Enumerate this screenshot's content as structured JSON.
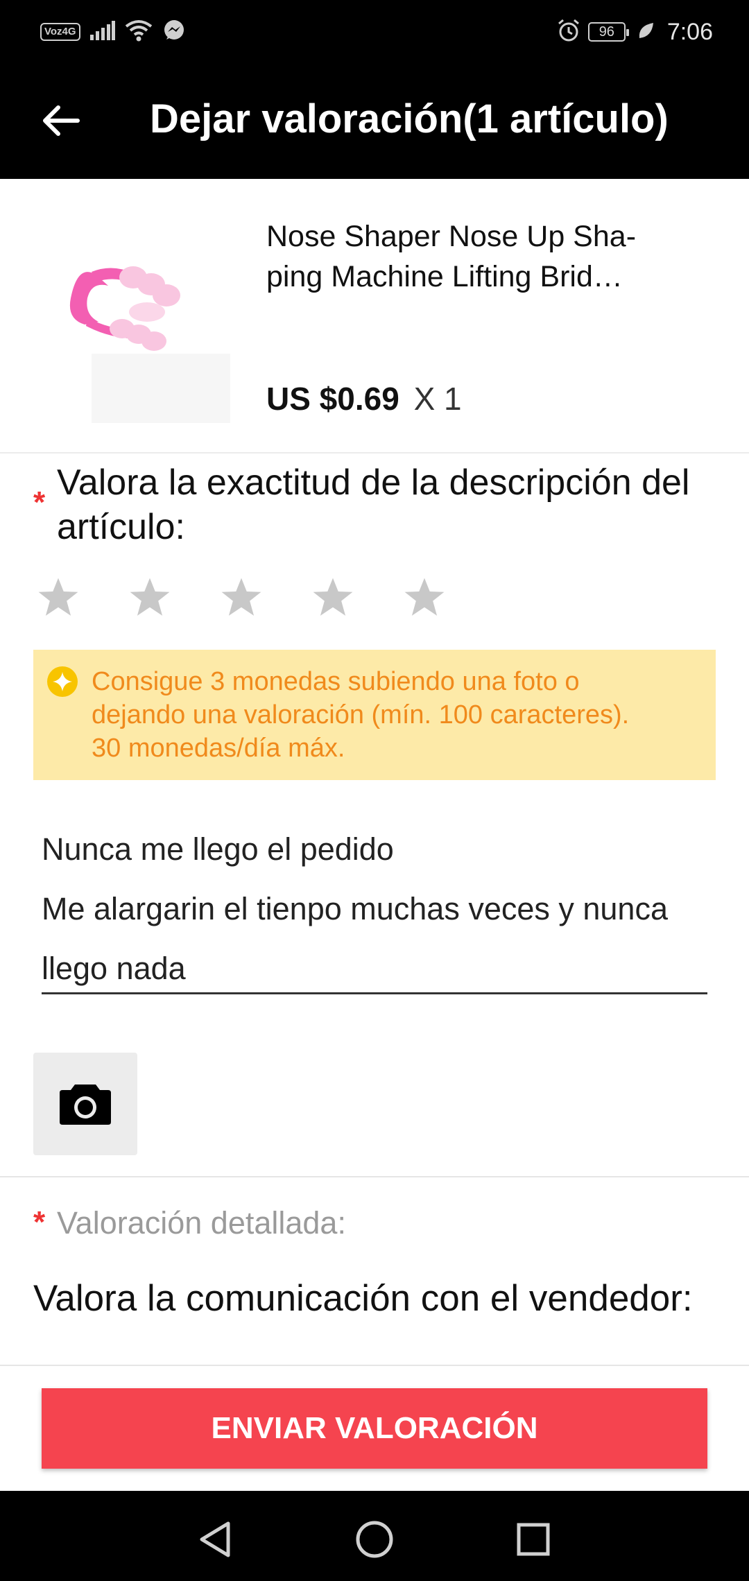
{
  "status_bar": {
    "network_badge": "Voz4G",
    "battery": "96",
    "time": "7:06",
    "icons": [
      "signal-icon",
      "wifi-icon",
      "messenger-icon",
      "alarm-icon",
      "battery-icon",
      "leaf-icon"
    ]
  },
  "header": {
    "title": "Dejar valoración(1 artículo)"
  },
  "product": {
    "name": "Nose Shaper Nose Up Sha-\nping Machine Lifting Brid…",
    "name_line1": "Nose Shaper Nose Up Sha-",
    "name_line2": "ping Machine Lifting Brid…",
    "price": "US $0.69",
    "quantity": "X 1"
  },
  "rating": {
    "required_mark": "*",
    "question": "Valora la exactitud de la descripción del artículo:",
    "max_stars": 5,
    "selected_stars": 0,
    "star_color": "#c8c8c8"
  },
  "notice": {
    "text": "Consigue 3 monedas subiendo una foto o dejando una valoración (mín. 100 caracteres). 30 monedas/día máx.",
    "line1": "Consigue 3 monedas subiendo una foto o",
    "line2": "dejando una valoración (mín. 100 caracteres).",
    "line3": "30 monedas/día máx.",
    "color": "#f08a1c",
    "background": "#fdeaa8"
  },
  "review": {
    "line1": "Nunca me llego el pedido",
    "line2": "Me alargarin el tienpo muchas veces y nunca",
    "line3": "llego nada"
  },
  "detailed": {
    "required_mark": "*",
    "label": "Valoración detallada:",
    "communication_question": "Valora la comunicación con el vendedor:"
  },
  "submit": {
    "label": "ENVIAR VALORACIÓN",
    "color": "#f5444f"
  }
}
